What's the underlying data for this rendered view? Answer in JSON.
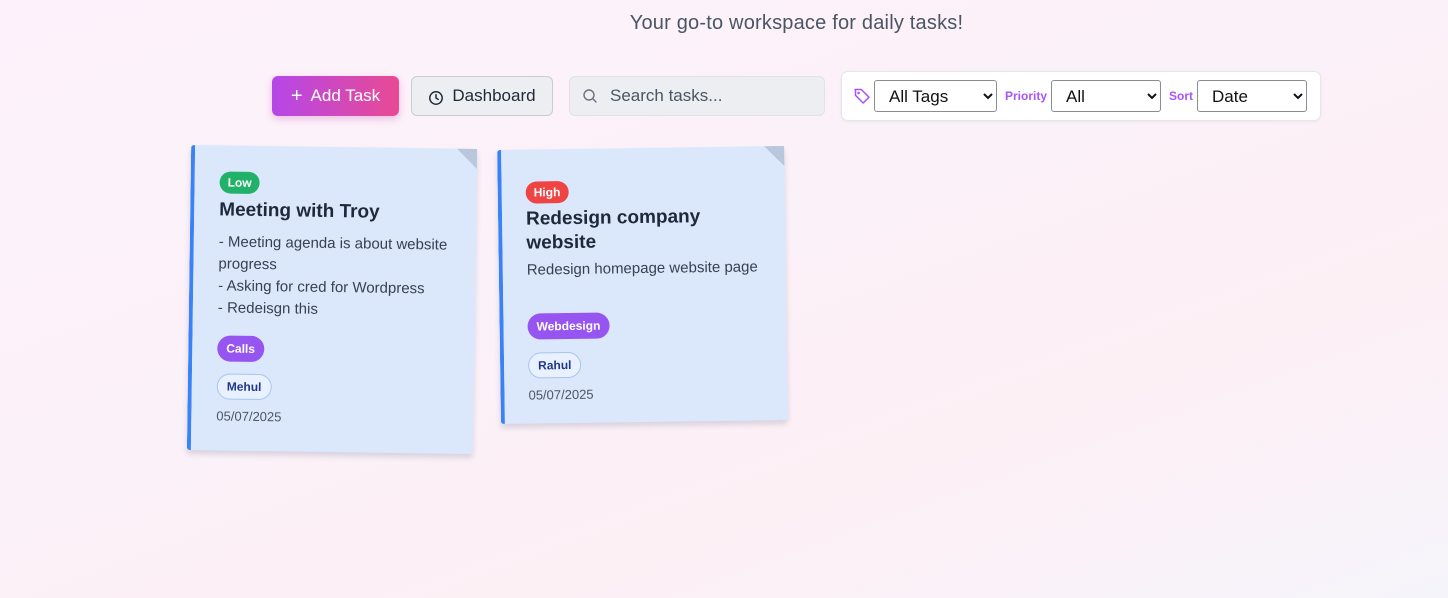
{
  "header": {
    "subtitle": "Your go-to workspace for daily tasks!"
  },
  "toolbar": {
    "add_label": "Add Task",
    "dashboard_label": "Dashboard",
    "search_placeholder": "Search tasks...",
    "tags_selected": "All Tags",
    "priority_label": "Priority",
    "priority_selected": "All",
    "sort_label": "Sort",
    "sort_selected": "Date"
  },
  "colors": {
    "accent_purple": "#a855f7",
    "accent_pink": "#e84a93",
    "card_bg": "#dbe8fc",
    "card_border": "#3b82f6",
    "priority_low": "#22b168",
    "priority_high": "#ef4444",
    "tag_bg": "#9655f0"
  },
  "tasks": [
    {
      "priority": "Low",
      "title": "Meeting with Troy",
      "description_lines": [
        "- Meeting agenda is about website progress",
        "- Asking for cred for Wordpress",
        "- Redeisgn this"
      ],
      "tag": "Calls",
      "assignee": "Mehul",
      "date": "05/07/2025"
    },
    {
      "priority": "High",
      "title": "Redesign company website",
      "description_lines": [
        "Redesign homepage website page"
      ],
      "tag": "Webdesign",
      "assignee": "Rahul",
      "date": "05/07/2025"
    }
  ]
}
